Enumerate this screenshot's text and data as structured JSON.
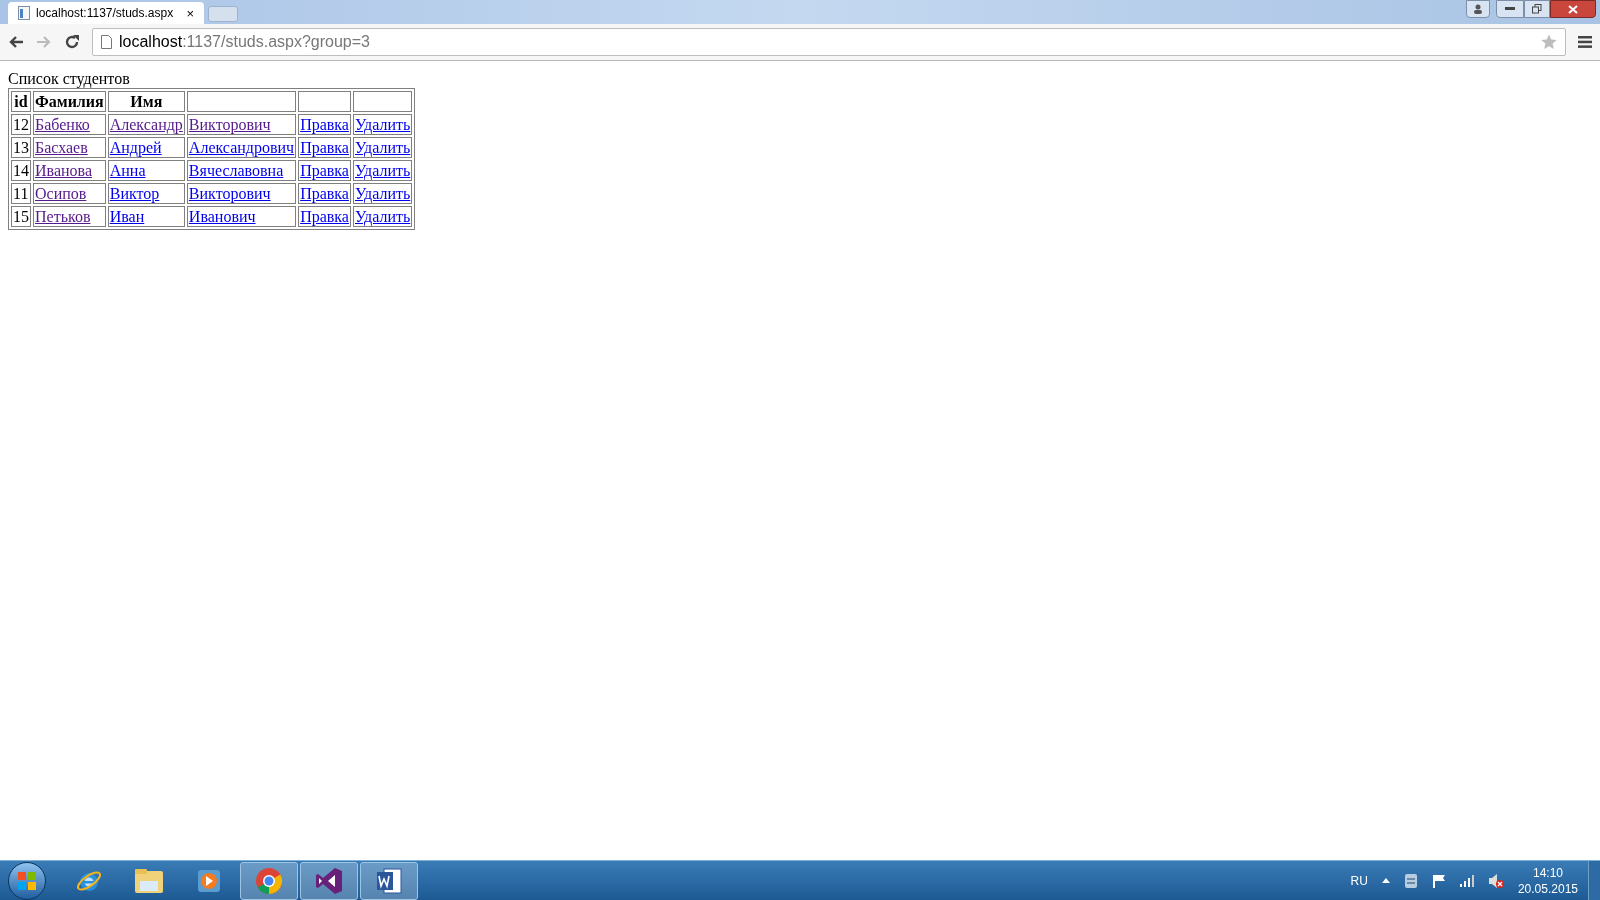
{
  "browser": {
    "tab": {
      "title": "localhost:1137/studs.aspx",
      "close": "×",
      "selected": true
    },
    "address": {
      "host": "localhost",
      "rest": ":1137/studs.aspx?group=3"
    }
  },
  "page": {
    "caption": "Список студентов",
    "columns": [
      "id",
      "Фамилия",
      "Имя"
    ],
    "rows": [
      {
        "id": "12",
        "links": [
          {
            "text": "Бабенко",
            "visited": true
          },
          {
            "text": "Александр",
            "visited": true
          },
          {
            "text": "Викторович",
            "visited": true
          },
          {
            "text": "Правка",
            "visited": false
          },
          {
            "text": "Удалить",
            "visited": false
          }
        ]
      },
      {
        "id": "13",
        "links": [
          {
            "text": "Басхаев",
            "visited": true
          },
          {
            "text": "Андрей",
            "visited": false
          },
          {
            "text": "Александрович",
            "visited": false
          },
          {
            "text": "Правка",
            "visited": false
          },
          {
            "text": "Удалить",
            "visited": false
          }
        ]
      },
      {
        "id": "14",
        "links": [
          {
            "text": "Иванова",
            "visited": true
          },
          {
            "text": "Анна",
            "visited": false
          },
          {
            "text": "Вячеславовна",
            "visited": false
          },
          {
            "text": "Правка",
            "visited": false
          },
          {
            "text": "Удалить",
            "visited": false
          }
        ]
      },
      {
        "id": "11",
        "links": [
          {
            "text": "Осипов",
            "visited": true
          },
          {
            "text": "Виктор",
            "visited": false
          },
          {
            "text": "Викторович",
            "visited": false
          },
          {
            "text": "Правка",
            "visited": false
          },
          {
            "text": "Удалить",
            "visited": false
          }
        ]
      },
      {
        "id": "15",
        "links": [
          {
            "text": "Петьков",
            "visited": true
          },
          {
            "text": "Иван",
            "visited": false
          },
          {
            "text": "Иванович",
            "visited": false
          },
          {
            "text": "Правка",
            "visited": false
          },
          {
            "text": "Удалить",
            "visited": false
          }
        ]
      }
    ]
  },
  "taskbar": {
    "apps": [
      {
        "kind": "ie",
        "active": false
      },
      {
        "kind": "explorer",
        "active": false
      },
      {
        "kind": "media",
        "active": false
      },
      {
        "kind": "chrome",
        "active": true
      },
      {
        "kind": "vs",
        "active": true
      },
      {
        "kind": "word",
        "active": true
      }
    ],
    "language": "RU",
    "time": "14:10",
    "date": "20.05.2015"
  }
}
